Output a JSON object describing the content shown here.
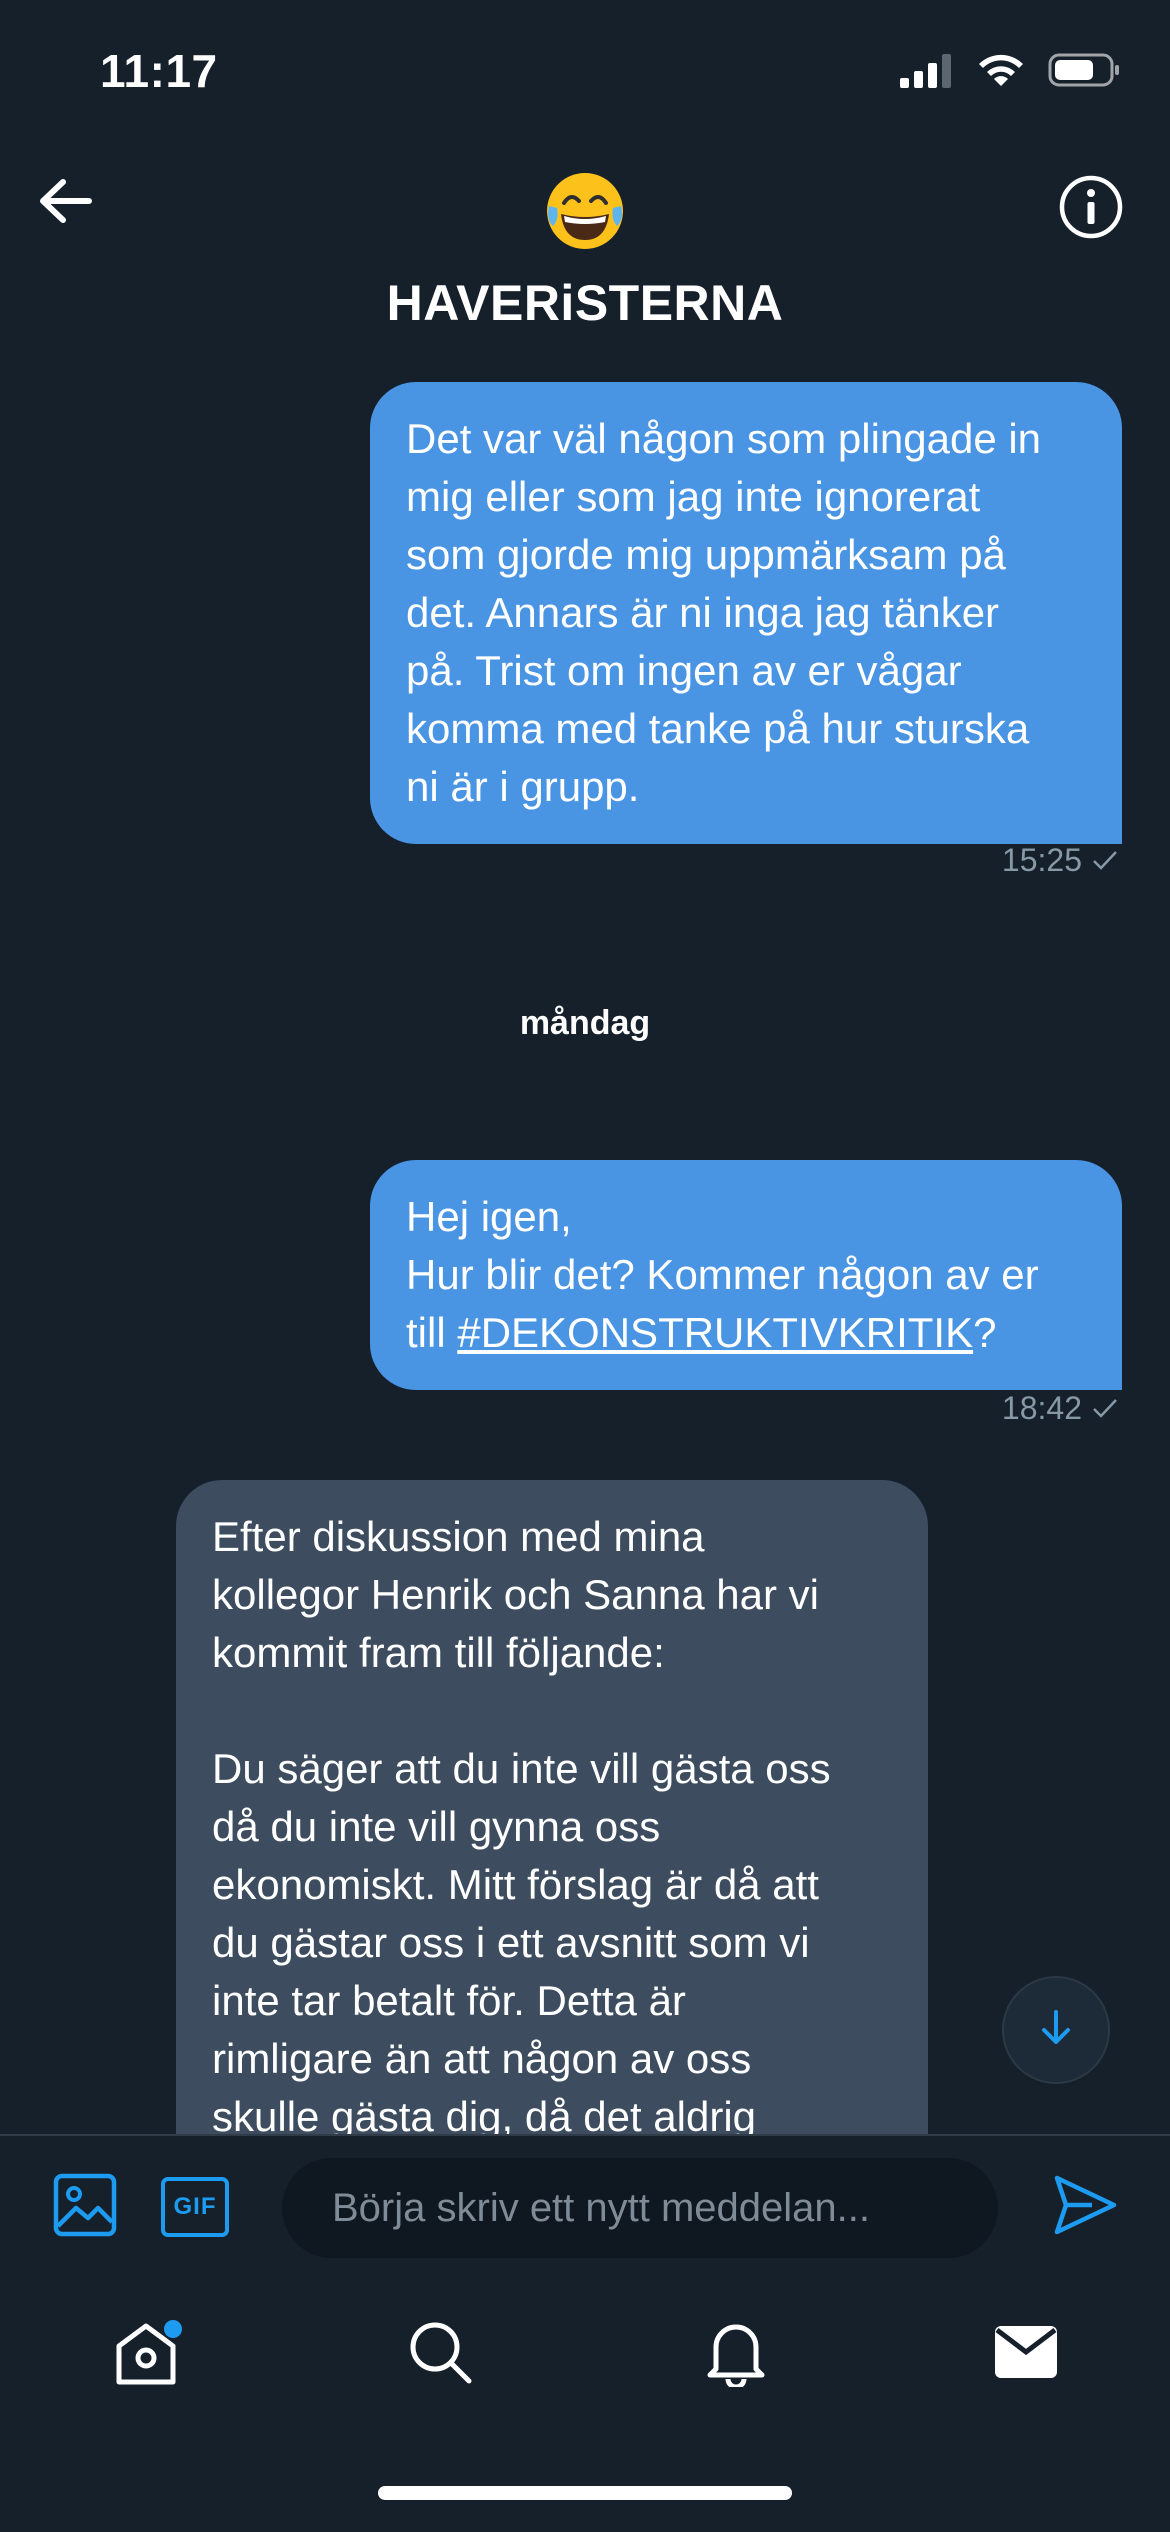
{
  "status_bar": {
    "time": "11:17"
  },
  "header": {
    "title": "HAVERiSTERNA",
    "avatar_emoji": "😂"
  },
  "messages": [
    {
      "direction": "outgoing",
      "text": "Det var väl någon som plingade in\nmig eller som jag inte ignorerat\nsom gjorde mig uppmärksam på\ndet. Annars är ni inga jag tänker\npå. Trist om ingen av er vågar\nkomma med tanke på hur sturska\nni är i grupp.",
      "time": "15:25"
    },
    {
      "direction": "outgoing",
      "text_line1": "Hej igen,",
      "text_line2": "Hur blir det? Kommer någon av er",
      "text_prefix": "till ",
      "hashtag": "#DEKONSTRUKTIVKRITIK",
      "text_suffix": "?",
      "time": "18:42"
    },
    {
      "direction": "incoming",
      "text": "Efter diskussion med mina\nkollegor Henrik och Sanna har vi\nkommit fram till följande:\n\nDu säger att du inte vill gästa oss\ndå du inte vill gynna oss\nekonomiskt. Mitt förslag är då att\ndu gästar oss i ett avsnitt som vi\ninte tar betalt för. Detta är\nrimligare än att någon av oss\nskulle gästa dig, då det aldrig"
    }
  ],
  "day_separator": "måndag",
  "composer": {
    "placeholder": "Börja skriv ett nytt meddelan...",
    "gif_label": "GIF"
  },
  "colors": {
    "background": "#15202b",
    "outgoing_bubble": "#4a94e4",
    "incoming_bubble": "#3d4d5f",
    "accent": "#1d9bf0",
    "meta_text": "#8899a6"
  },
  "icons": {
    "back": "arrow-left-icon",
    "info": "info-icon",
    "image": "image-icon",
    "gif": "gif-icon",
    "send": "send-icon",
    "home": "home-icon",
    "search": "search-icon",
    "notifications": "bell-icon",
    "messages": "mail-icon",
    "scroll_down": "arrow-down-icon",
    "read_receipt": "checkmark-icon"
  }
}
